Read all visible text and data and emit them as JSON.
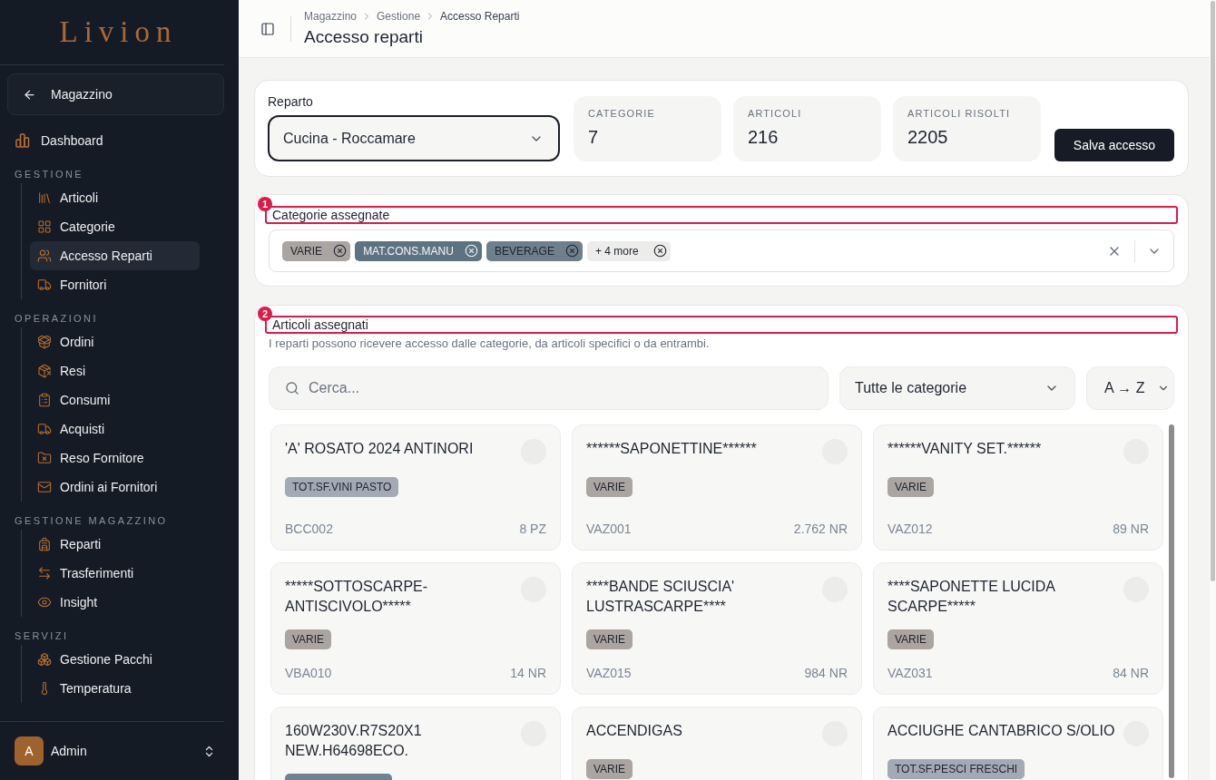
{
  "sidebar": {
    "logo": "Livion",
    "back_button": {
      "label": "Magazzino"
    },
    "top_items": [
      {
        "label": "Dashboard",
        "selected": false
      }
    ],
    "sections": [
      {
        "title": "GESTIONE",
        "items": [
          {
            "label": "Articoli",
            "selected": false
          },
          {
            "label": "Categorie",
            "selected": false
          },
          {
            "label": "Accesso Reparti",
            "selected": true
          },
          {
            "label": "Fornitori",
            "selected": false
          }
        ]
      },
      {
        "title": "OPERAZIONI",
        "items": [
          {
            "label": "Ordini",
            "selected": false
          },
          {
            "label": "Resi",
            "selected": false
          },
          {
            "label": "Consumi",
            "selected": false
          },
          {
            "label": "Acquisti",
            "selected": false
          },
          {
            "label": "Reso Fornitore",
            "selected": false
          },
          {
            "label": "Ordini ai Fornitori",
            "selected": false
          }
        ]
      },
      {
        "title": "GESTIONE MAGAZZINO",
        "items": [
          {
            "label": "Reparti",
            "selected": false
          },
          {
            "label": "Trasferimenti",
            "selected": false
          },
          {
            "label": "Insight",
            "selected": false
          }
        ]
      },
      {
        "title": "SERVIZI",
        "items": [
          {
            "label": "Gestione Pacchi",
            "selected": false
          },
          {
            "label": "Temperatura",
            "selected": false
          }
        ]
      }
    ],
    "user": {
      "initial": "A",
      "name": "Admin"
    }
  },
  "header": {
    "breadcrumb": [
      "Magazzino",
      "Gestione",
      "Accesso Reparti"
    ],
    "title": "Accesso reparti"
  },
  "department": {
    "label": "Reparto",
    "value": "Cucina - Roccamare"
  },
  "stats": [
    {
      "label": "CATEGORIE",
      "value": "7"
    },
    {
      "label": "ARTICOLI",
      "value": "216"
    },
    {
      "label": "ARTICOLI RISOLTI",
      "value": "2205"
    }
  ],
  "save_button": "Salva accesso",
  "categories": {
    "annotation": "1",
    "label": "Categorie assegnate",
    "tags": [
      {
        "label": "VARIE",
        "color": "#aaa5a0"
      },
      {
        "label": "MAT.CONS.MANU",
        "color": "#5e7381"
      },
      {
        "label": "BEVERAGE",
        "color": "#6d808c"
      }
    ],
    "more": "+ 4 more"
  },
  "articles": {
    "annotation": "2",
    "label": "Articoli assegnati",
    "description": "I reparti possono ricevere accesso dalle categorie, da articoli specifici o da entrambi.",
    "search": {
      "placeholder": "Cerca..."
    },
    "category_filter": {
      "value": "Tutte le categorie"
    },
    "sort": {
      "value": "A → Z"
    },
    "items": [
      {
        "name": "'A' ROSATO 2024 ANTINORI",
        "tag": {
          "label": "TOT.SF.VINI PASTO",
          "color": "#a3aab5"
        },
        "code": "BCC002",
        "quantity": "8 PZ",
        "selected": false
      },
      {
        "name": "******SAPONETTINE******",
        "tag": {
          "label": "VARIE",
          "color": "#aaa5a0"
        },
        "code": "VAZ001",
        "quantity": "2.762 NR",
        "selected": false
      },
      {
        "name": "******VANITY SET.******",
        "tag": {
          "label": "VARIE",
          "color": "#aaa5a0"
        },
        "code": "VAZ012",
        "quantity": "89 NR",
        "selected": false
      },
      {
        "name": "*****SOTTOSCARPE-ANTISCIVOLO*****",
        "tag": {
          "label": "VARIE",
          "color": "#aaa5a0"
        },
        "code": "VBA010",
        "quantity": "14 NR",
        "selected": false
      },
      {
        "name": "****BANDE SCIUSCIA' LUSTRASCARPE****",
        "tag": {
          "label": "VARIE",
          "color": "#aaa5a0"
        },
        "code": "VAZ015",
        "quantity": "984 NR",
        "selected": false
      },
      {
        "name": "****SAPONETTE LUCIDA SCARPE*****",
        "tag": {
          "label": "VARIE",
          "color": "#aaa5a0"
        },
        "code": "VAZ031",
        "quantity": "84 NR",
        "selected": false
      },
      {
        "name": "160W230V.R7S20X1 NEW.H64698ECO.",
        "tag": {
          "color": "#6f8290"
        },
        "selected": false
      },
      {
        "name": "ACCENDIGAS",
        "tag": {
          "label": "VARIE",
          "color": "#aaa5a0"
        },
        "selected": false
      },
      {
        "name": "ACCIUGHE CANTABRICO S/OLIO",
        "tag": {
          "label": "TOT.SF.PESCI FRESCHI",
          "color": "#a3aab5"
        },
        "selected": false
      }
    ]
  }
}
